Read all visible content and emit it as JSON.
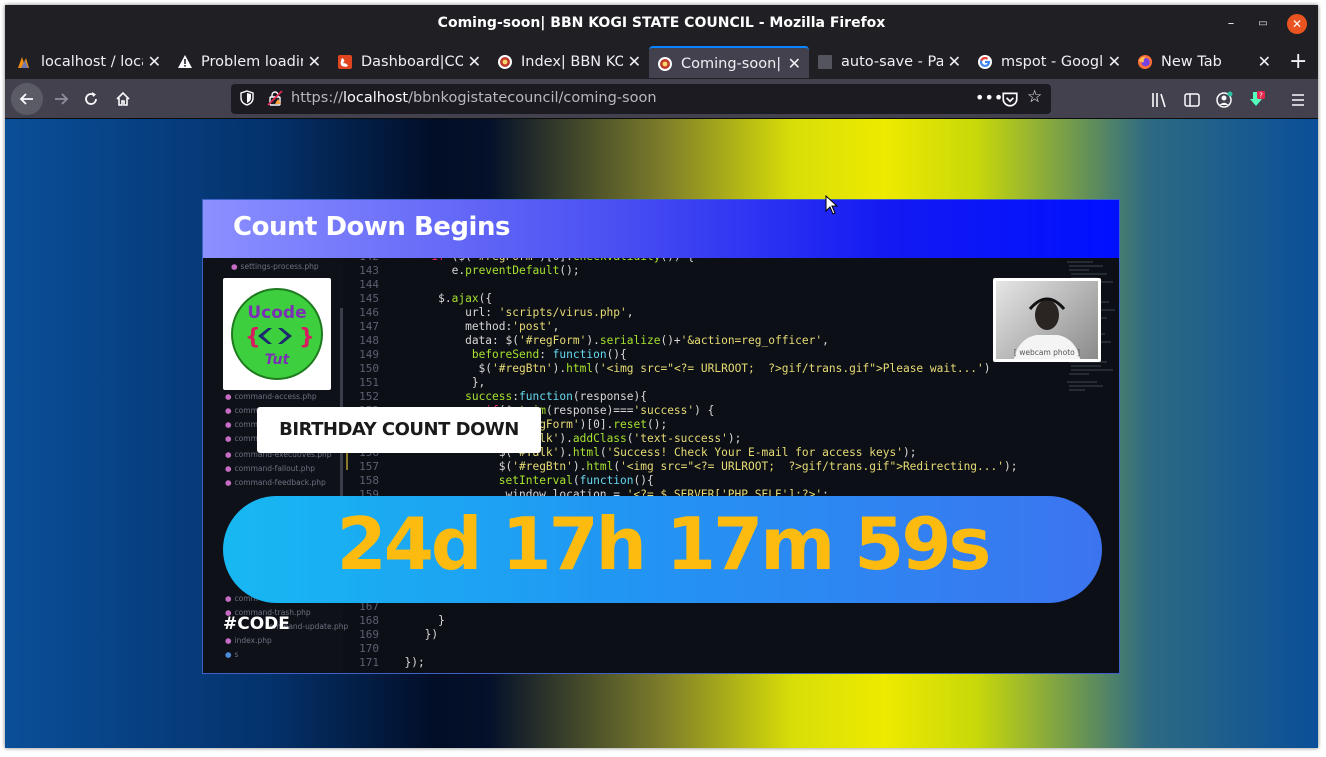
{
  "window": {
    "title": "Coming-soon| BBN KOGI STATE COUNCIL - Mozilla Firefox"
  },
  "tabs": [
    {
      "label": "localhost / loca",
      "icon": "phpmyadmin-icon"
    },
    {
      "label": "Problem loadin",
      "icon": "warning-icon"
    },
    {
      "label": "Dashboard|CO",
      "icon": "codeigniter-icon"
    },
    {
      "label": "Index| BBN KO",
      "icon": "site-favicon"
    },
    {
      "label": "Coming-soon| B",
      "icon": "site-favicon",
      "active": true
    },
    {
      "label": "auto-save - Pac",
      "icon": "blank-page-icon"
    },
    {
      "label": "mspot - Google",
      "icon": "google-icon"
    },
    {
      "label": "New Tab",
      "icon": "firefox-icon"
    }
  ],
  "navbar": {
    "url_prefix": "https://",
    "url_host": "localhost",
    "url_path": "/bbnkogistatecouncil/coming-soon",
    "url_more": "•••",
    "download_badge": "?"
  },
  "page": {
    "card_title": "Count Down Begins",
    "birthday_label": "BIRTHDAY COUNT DOWN",
    "countdown": "24d 17h 17m 59s",
    "hashtag": "#CODE",
    "logo": {
      "line1": "Ucode",
      "line2": "Tut"
    }
  },
  "code_background": {
    "files": [
      {
        "name": "settings-process.php"
      },
      {
        "name": "command-access.php"
      },
      {
        "name": "comm"
      },
      {
        "name": "comm"
      },
      {
        "name": "comm"
      },
      {
        "name": "command-executives.php"
      },
      {
        "name": "command-fallout.php"
      },
      {
        "name": "command-feedback.php"
      },
      {
        "name": "comm"
      },
      {
        "name": "command-trash.php"
      },
      {
        "name": "command-update.php"
      },
      {
        "name": "index.php"
      },
      {
        "name": "s"
      }
    ],
    "line_numbers": [
      "142",
      "143",
      "144",
      "145",
      "146",
      "147",
      "148",
      "149",
      "150",
      "151",
      "152",
      "153",
      "154",
      "155",
      "156",
      "157",
      "158",
      "159",
      "167",
      "168",
      "169",
      "170",
      "171"
    ]
  },
  "colors": {
    "countdown_text": "#fdbb10",
    "pill_start": "#17b8f2",
    "pill_end": "#3c74f0",
    "header_end": "#0010ff"
  }
}
